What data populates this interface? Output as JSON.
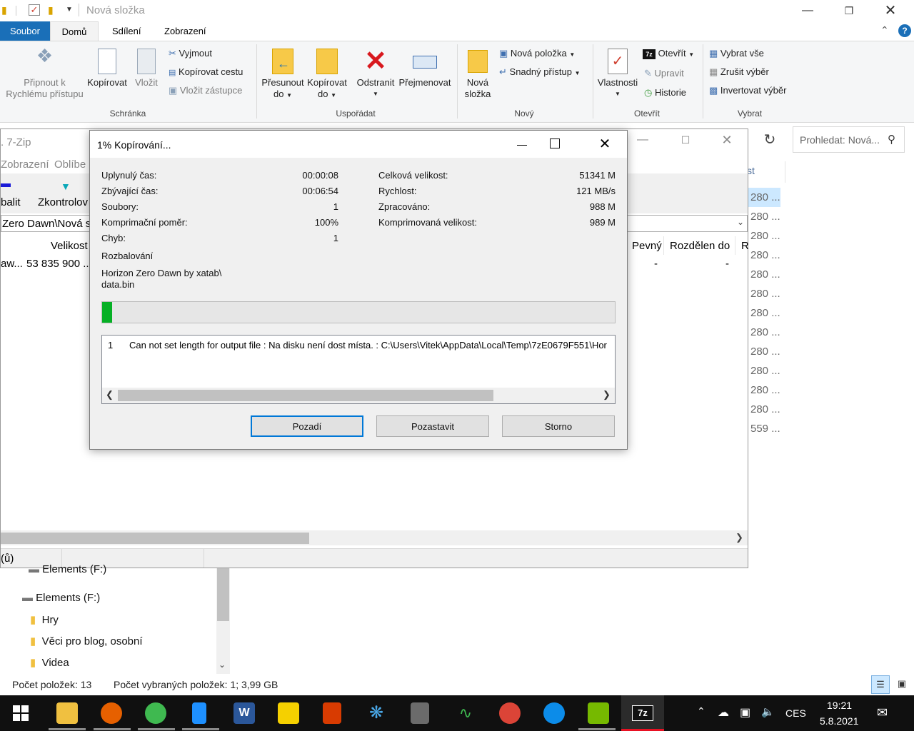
{
  "explorer": {
    "title": "Nová složka",
    "tabs": [
      "Soubor",
      "Domů",
      "Sdílení",
      "Zobrazení"
    ],
    "ribbon": {
      "clipboard": {
        "pin_line1": "Připnout k",
        "pin_line2": "Rychlému přístupu",
        "copy": "Kopírovat",
        "paste": "Vložit",
        "cut": "Vyjmout",
        "copy_path": "Kopírovat cestu",
        "paste_shortcut": "Vložit zástupce",
        "label": "Schránka"
      },
      "organize": {
        "move_line1": "Přesunout",
        "move_line2": "do",
        "copyto_line1": "Kopírovat",
        "copyto_line2": "do",
        "delete": "Odstranit",
        "rename": "Přejmenovat",
        "label": "Uspořádat"
      },
      "new": {
        "folder_line1": "Nová",
        "folder_line2": "složka",
        "new_item": "Nová položka",
        "easy_access": "Snadný přístup",
        "label": "Nový"
      },
      "open": {
        "properties": "Vlastnosti",
        "open": "Otevřít",
        "edit": "Upravit",
        "history": "Historie",
        "label": "Otevřít"
      },
      "select": {
        "select_all": "Vybrat vše",
        "select_none": "Zrušit výběr",
        "invert": "Invertovat výběr",
        "label": "Vybrat"
      }
    },
    "search_placeholder": "Prohledat: Nová...",
    "right_column_values": [
      "280 ...",
      "280 ...",
      "280 ...",
      "280 ...",
      "280 ...",
      "280 ...",
      "280 ...",
      "280 ...",
      "280 ...",
      "280 ...",
      "280 ...",
      "280 ...",
      "559 ..."
    ],
    "right_header_fragment": "st",
    "nav": {
      "drive_partial": "Elements (F:)",
      "drive": "Elements (F:)",
      "folders": [
        "Hry",
        "Věci pro blog, osobní",
        "Videa"
      ]
    },
    "status": {
      "count": "Počet položek: 13",
      "selected": "Počet vybraných položek: 1; 3,99 GB"
    }
  },
  "sevenzip_window": {
    "title_fragment": ". 7-Zip",
    "menu": [
      "Zobrazení",
      "Oblíbe"
    ],
    "toolbar": [
      "balit",
      "Zkontrolov"
    ],
    "path_fragment": "Zero Dawn\\Nová s",
    "columns": [
      "Velikost",
      "Pevný",
      "Rozdělen do",
      "R"
    ],
    "row": {
      "name_fragment": "aw...",
      "size": "53 835 900 ...",
      "fixed": "-",
      "split": "-"
    },
    "status_fragment": "(ů)"
  },
  "dialog": {
    "title": "1% Kopírování...",
    "left_stats": [
      {
        "label": "Uplynulý čas:",
        "value": "00:00:08"
      },
      {
        "label": "Zbývající čas:",
        "value": "00:06:54"
      },
      {
        "label": "Soubory:",
        "value": "1"
      },
      {
        "label": "Komprimační poměr:",
        "value": "100%"
      },
      {
        "label": "Chyb:",
        "value": "1"
      }
    ],
    "right_stats": [
      {
        "label": "Celková velikost:",
        "value": "51341 M"
      },
      {
        "label": "Rychlost:",
        "value": "121 MB/s"
      },
      {
        "label": "Zpracováno:",
        "value": "988 M"
      },
      {
        "label": "Komprimovaná velikost:",
        "value": "989 M"
      }
    ],
    "operation": "Rozbalování",
    "current_file_line1": "Horizon Zero Dawn by xatab\\",
    "current_file_line2": "data.bin",
    "progress": 0.02,
    "progress_color": "#06b025",
    "error_index": "1",
    "error_text": "Can not set length for output file : Na disku není dost místa. : C:\\Users\\Vitek\\AppData\\Local\\Temp\\7zE0679F551\\Hor",
    "buttons": {
      "background": "Pozadí",
      "pause": "Pozastavit",
      "cancel": "Storno"
    }
  },
  "taskbar": {
    "time": "19:21",
    "date": "5.8.2021",
    "lang": "CES"
  }
}
